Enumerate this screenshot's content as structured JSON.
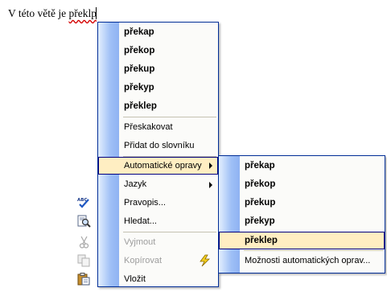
{
  "document": {
    "text_before": "V této větě je ",
    "misspelled_word": "překlp"
  },
  "context_menu": {
    "suggestions": [
      "překap",
      "překop",
      "překup",
      "překyp",
      "překlep"
    ],
    "ignore_all": "Přeskakovat",
    "add_to_dictionary": "Přidat do slovníku",
    "autocorrect": "Automatické opravy",
    "language": "Jazyk",
    "spelling": "Pravopis...",
    "find": "Hledat...",
    "cut": "Vyjmout",
    "copy": "Kopírovat",
    "paste": "Vložit",
    "icons": {
      "spelling": "spell-check-icon",
      "find": "research-icon",
      "cut": "scissors-icon",
      "copy": "copy-icon",
      "paste": "clipboard-icon"
    }
  },
  "autocorrect_submenu": {
    "suggestions": [
      "překap",
      "překop",
      "překup",
      "překyp",
      "překlep"
    ],
    "options": "Možnosti automatických oprav...",
    "options_icon": "lightning-icon",
    "highlighted": "překlep"
  },
  "colors": {
    "menu_border": "#002d96",
    "highlight_fill": "#ffeec2",
    "highlight_border": "#000080",
    "gutter": "#9ebff6",
    "spell_error_underline": "#d40000"
  }
}
